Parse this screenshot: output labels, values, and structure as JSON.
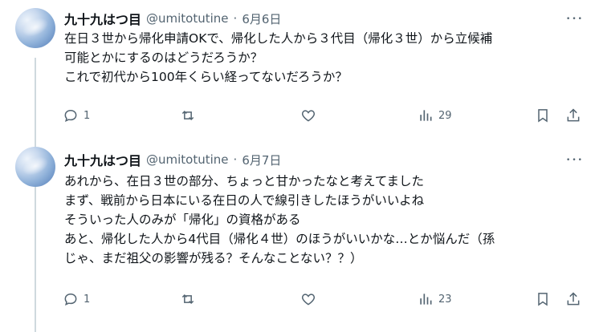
{
  "tweets": [
    {
      "name": "九十九はつ目",
      "handle": "@umitotutine",
      "separator": "·",
      "date": "6月6日",
      "more": "•••",
      "lines": [
        "在日３世から帰化申請OKで、帰化した人から３代目（帰化３世）から立候補",
        "可能とかにするのはどうだろうか？",
        "これで初代から100年くらい経ってないだろうか？"
      ],
      "reply_count": "1",
      "retweet_count": "",
      "like_count": "",
      "view_count": "29"
    },
    {
      "name": "九十九はつ目",
      "handle": "@umitotutine",
      "separator": "·",
      "date": "6月7日",
      "more": "•••",
      "lines": [
        "あれから、在日３世の部分、ちょっと甘かったなと考えてました",
        "まず、戦前から日本にいる在日の人で線引きしたほうがいいよね",
        "そういった人のみが「帰化」の資格がある",
        "あと、帰化した人から4代目（帰化４世）のほうがいいかな…とか悩んだ（孫",
        "じゃ、まだ祖父の影響が残る？そんなことない？？）"
      ],
      "reply_count": "1",
      "retweet_count": "",
      "like_count": "",
      "view_count": "23"
    }
  ]
}
